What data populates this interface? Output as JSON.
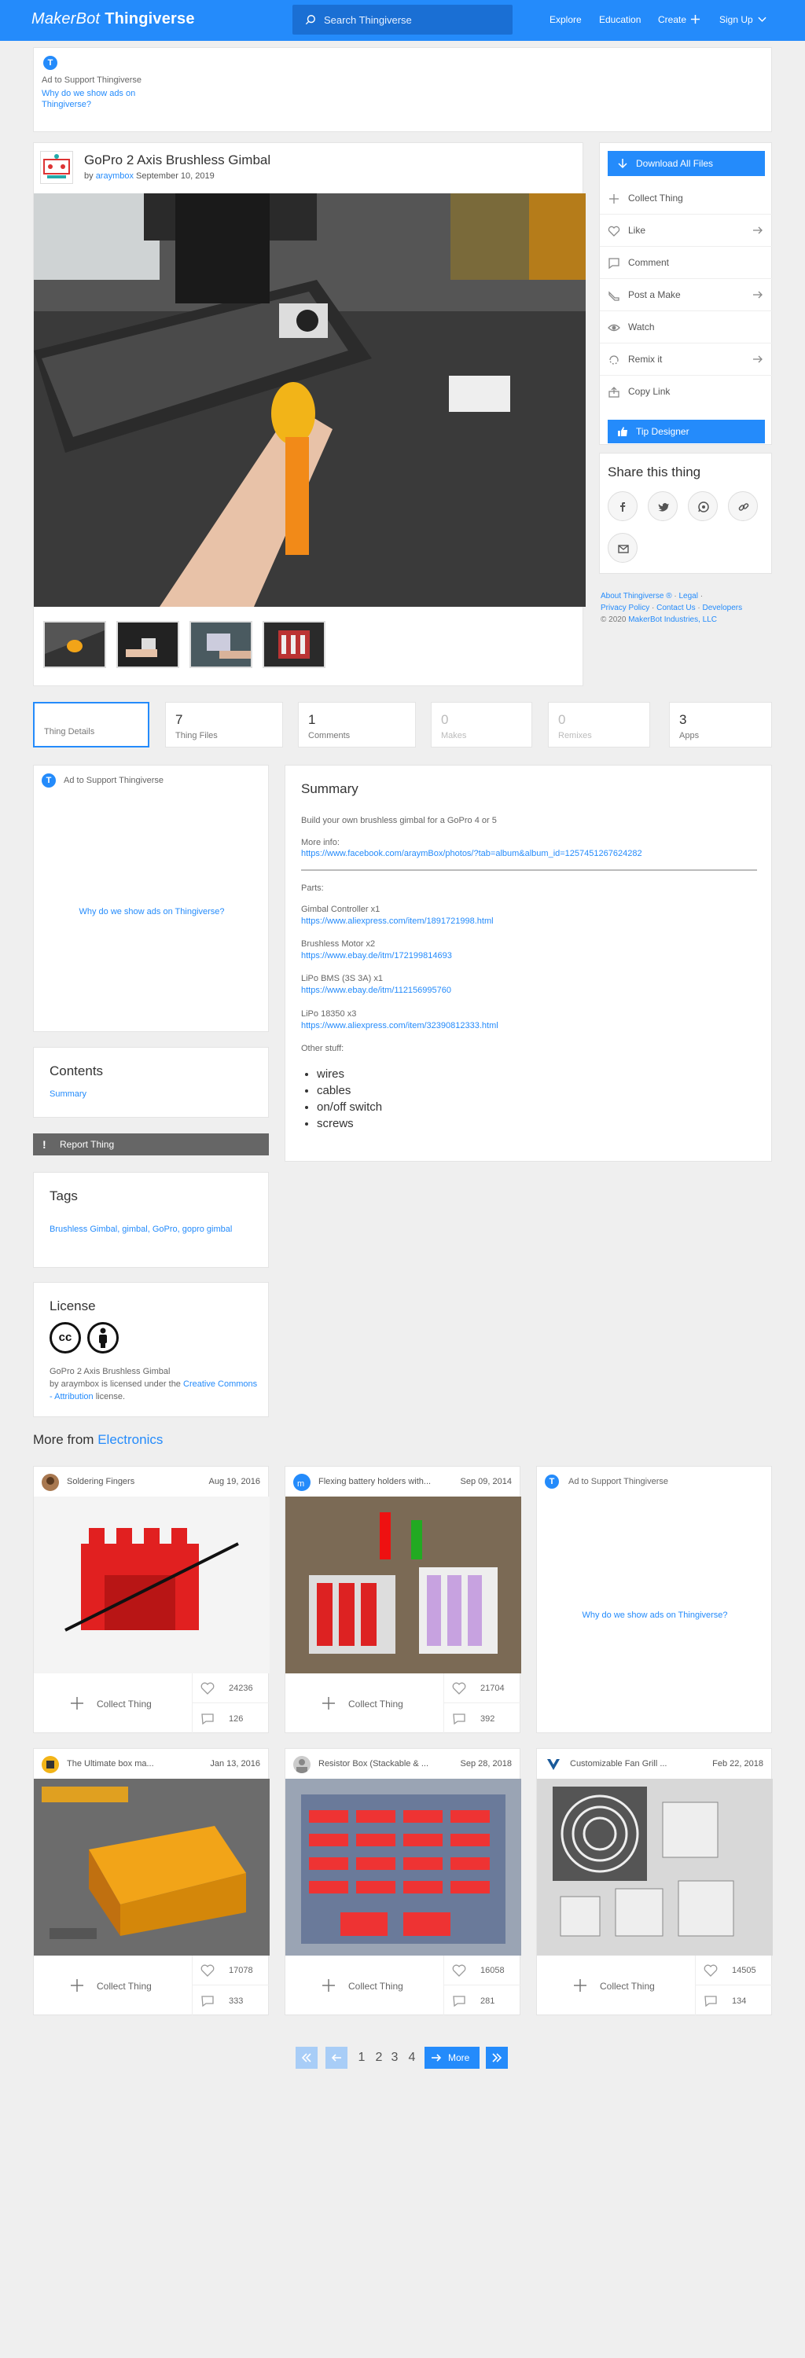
{
  "header": {
    "logo_prefix": "MakerBot",
    "logo_main": "Thingiverse",
    "search_placeholder": "Search Thingiverse",
    "nav": [
      "Explore",
      "Education",
      "Create",
      "Sign Up"
    ]
  },
  "ad_top": {
    "badge": "T",
    "label": "Ad to Support Thingiverse",
    "why": "Why do we show ads on Thingiverse?"
  },
  "thing": {
    "title": "GoPro 2 Axis Brushless Gimbal",
    "by_prefix": "by",
    "author": "araymbox",
    "date": "September 10, 2019"
  },
  "actions": {
    "download": "Download All Files",
    "items": [
      "Collect Thing",
      "Like",
      "Comment",
      "Post a Make",
      "Watch",
      "Remix it",
      "Copy Link"
    ],
    "tip": "Tip Designer"
  },
  "share": {
    "title": "Share this thing",
    "icons": [
      "facebook-icon",
      "twitter-icon",
      "whatsapp-icon",
      "link-icon",
      "email-icon"
    ]
  },
  "footer": {
    "about": "About Thingiverse ®",
    "legal": "Legal",
    "privacy": "Privacy Policy",
    "contact": "Contact Us",
    "developers": "Developers",
    "copyright": "© 2020",
    "company": "MakerBot Industries, LLC"
  },
  "tabs": [
    {
      "num": "",
      "label": "Thing Details"
    },
    {
      "num": "7",
      "label": "Thing Files"
    },
    {
      "num": "1",
      "label": "Comments"
    },
    {
      "num": "0",
      "label": "Makes"
    },
    {
      "num": "0",
      "label": "Remixes"
    },
    {
      "num": "3",
      "label": "Apps"
    }
  ],
  "side_ad": {
    "label": "Ad to Support Thingiverse",
    "why": "Why do we show ads on Thingiverse?"
  },
  "contents": {
    "title": "Contents",
    "link": "Summary"
  },
  "report": "Report Thing",
  "tags": {
    "title": "Tags",
    "text": "Brushless Gimbal, gimbal, GoPro, gopro gimbal"
  },
  "license": {
    "title": "License",
    "line1": "GoPro 2 Axis Brushless Gimbal",
    "line2": "by araymbox is licensed under the",
    "link": "Creative Commons - Attribution",
    "end": "license."
  },
  "summary": {
    "title": "Summary",
    "intro": "Build your own brushless gimbal for a GoPro 4 or 5",
    "more_info": "More info:",
    "fb_link": "https://www.facebook.com/araymBox/photos/?tab=album&album_id=1257451267624282",
    "parts": "Parts:",
    "p1": "Gimbal Controller x1",
    "p1_link": "https://www.aliexpress.com/item/1891721998.html",
    "p2": "Brushless Motor x2",
    "p2_link": "https://www.ebay.de/itm/172199814693",
    "p3": "LiPo BMS (3S 3A) x1",
    "p3_link": "https://www.ebay.de/itm/112156995760",
    "p4": "LiPo 18350 x3",
    "p4_link": "https://www.aliexpress.com/item/32390812333.html",
    "other": "Other stuff:",
    "list": [
      "wires",
      "cables",
      "on/off switch",
      "screws"
    ]
  },
  "more_from": {
    "prefix": "More from",
    "category": "Electronics"
  },
  "grid": [
    {
      "title": "Soldering Fingers",
      "date": "Aug 19, 2016",
      "likes": "24236",
      "comments": "126",
      "collect": "Collect Thing"
    },
    {
      "title": "Flexing battery holders with...",
      "date": "Sep 09, 2014",
      "likes": "21704",
      "comments": "392",
      "collect": "Collect Thing"
    },
    {
      "title": "The Ultimate box ma...",
      "date": "Jan 13, 2016",
      "likes": "17078",
      "comments": "333",
      "collect": "Collect Thing"
    },
    {
      "title": "Resistor Box (Stackable & ...",
      "date": "Sep 28, 2018",
      "likes": "16058",
      "comments": "281",
      "collect": "Collect Thing"
    },
    {
      "title": "Customizable Fan Grill ...",
      "date": "Feb 22, 2018",
      "likes": "14505",
      "comments": "134",
      "collect": "Collect Thing"
    }
  ],
  "pagination": {
    "pages": [
      "1",
      "2",
      "3",
      "4"
    ],
    "more": "More"
  }
}
